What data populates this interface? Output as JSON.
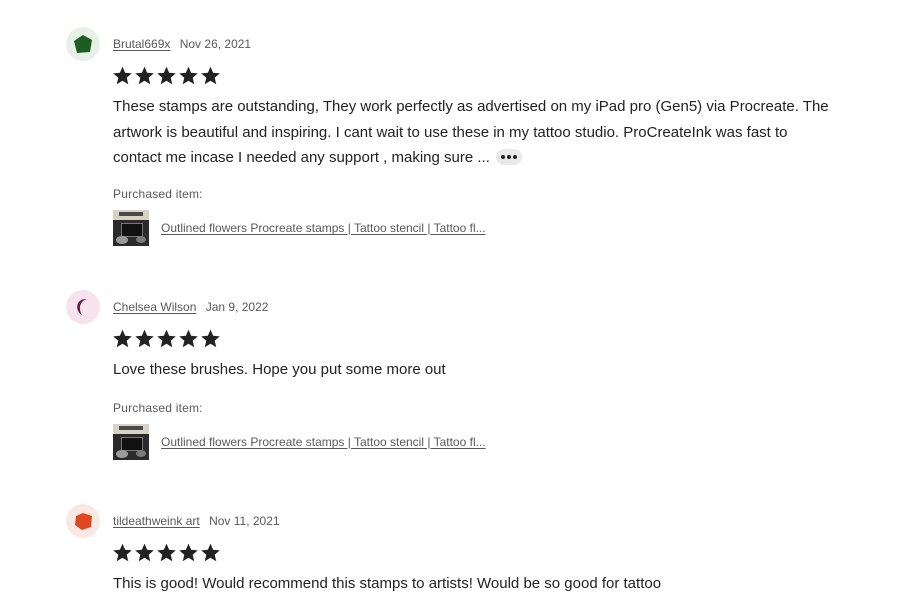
{
  "reviews": [
    {
      "reviewer": "Brutal669x",
      "date": "Nov 26, 2021",
      "rating": 5,
      "avatar_color": "#1e5d22",
      "avatar_bg": "#e8f1e8",
      "avatar_icon": "pentagon-icon",
      "text": "These stamps are outstanding, They work perfectly as advertised on my iPad pro (Gen5) via Procreate. The artwork is beautiful and inspiring. I cant wait to use these in my tattoo studio. ProCreateInk was fast to contact me incase I needed any support , making sure ...",
      "purchased_label": "Purchased item:",
      "item_title": "Outlined flowers Procreate stamps | Tattoo stencil | Tattoo fl..."
    },
    {
      "reviewer": "Chelsea Wilson",
      "date": "Jan 9, 2022",
      "rating": 5,
      "avatar_color": "#6b1d45",
      "avatar_bg": "#f6e3ee",
      "avatar_icon": "crescent-icon",
      "text": "Love these brushes. Hope you put some more out",
      "purchased_label": "Purchased item:",
      "item_title": "Outlined flowers Procreate stamps | Tattoo stencil | Tattoo fl..."
    },
    {
      "reviewer": "tildeathweink art",
      "date": "Nov 11, 2021",
      "rating": 5,
      "avatar_color": "#e0461f",
      "avatar_bg": "#fce8e2",
      "avatar_icon": "pentagon-icon",
      "text": "This is good! Would recommend this stamps to artists! Would be so good for tattoo"
    }
  ],
  "more_button_icon": "ellipsis-icon",
  "star_icon": "star-icon",
  "star_color": "#222222"
}
